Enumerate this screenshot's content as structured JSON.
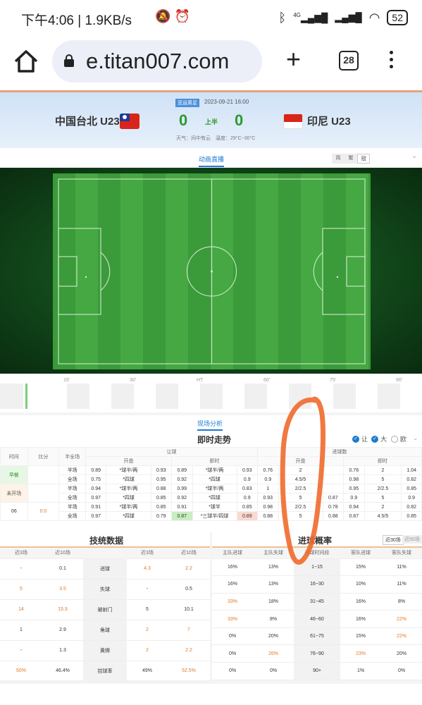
{
  "status_bar": {
    "time": "下午4:06",
    "speed": "1.9KB/s",
    "network": "4G",
    "battery": "52"
  },
  "browser": {
    "url": "e.titan007.com",
    "tab_count": "28"
  },
  "match": {
    "league": "亚运男足",
    "datetime": "2023-09-21 16:00",
    "home_team": "中国台北 U23",
    "away_team": "印尼 U23",
    "home_score": "0",
    "away_score": "0",
    "period": "上半",
    "weather": "天气：间中有云",
    "temperature": "温度：29°C~30°C"
  },
  "live_tab": {
    "label": "动画直播",
    "lang_options": [
      "简",
      "繁",
      "冠"
    ]
  },
  "timeline": {
    "labels": [
      "15'",
      "30'",
      "HT",
      "60'",
      "75'",
      "90'"
    ]
  },
  "analysis": {
    "tab": "现场分析",
    "title": "即时走势",
    "options": [
      "让",
      "大",
      "欧"
    ],
    "headers": {
      "time": "时间",
      "score": "比分",
      "half_full": "半全场",
      "handicap": "让球",
      "total": "进球数",
      "open": "开盘",
      "live": "即时"
    },
    "rows": [
      {
        "label": "早餐",
        "score": "",
        "type": "半场",
        "h_open": [
          "0.89",
          "*球半/两",
          "0.93"
        ],
        "h_live": [
          "0.89",
          "*球半/两",
          "0.93"
        ],
        "t_open": [
          "0.76",
          "2",
          ""
        ],
        "t_live": [
          "0.76",
          "2",
          "1.04"
        ]
      },
      {
        "label": "",
        "score": "",
        "type": "全场",
        "h_open": [
          "0.75",
          "*四球",
          "0.95"
        ],
        "h_live": [
          "0.92",
          "*四球",
          "0.9"
        ],
        "t_open": [
          "0.9",
          "4.5/5",
          ""
        ],
        "t_live": [
          "0.98",
          "5",
          "0.82"
        ]
      },
      {
        "label": "未开场",
        "score": "",
        "type": "半场",
        "h_open": [
          "0.94",
          "*球半/两",
          "0.88"
        ],
        "h_live": [
          "0.99",
          "*球半/两",
          "0.83"
        ],
        "t_open": [
          "1",
          "2/2.5",
          ""
        ],
        "t_live": [
          "0.95",
          "2/2.5",
          "0.85"
        ]
      },
      {
        "label": "",
        "score": "",
        "type": "全场",
        "h_open": [
          "0.97",
          "*四球",
          "0.85"
        ],
        "h_live": [
          "0.92",
          "*四球",
          "0.9"
        ],
        "t_open": [
          "0.93",
          "5",
          "0.87"
        ],
        "t_live": [
          "0.9",
          "5",
          "0.9"
        ]
      },
      {
        "label": "06",
        "score": "0:0",
        "type": "半场",
        "h_open": [
          "0.91",
          "*球半/两",
          "0.85"
        ],
        "h_live": [
          "0.91",
          "*球半",
          "0.85"
        ],
        "t_open": [
          "0.98",
          "2/2.5",
          "0.78"
        ],
        "t_live": [
          "0.94",
          "2",
          "0.82"
        ]
      },
      {
        "label": "",
        "score": "",
        "type": "全场",
        "h_open": [
          "0.97",
          "*四球",
          "0.79"
        ],
        "h_live": [
          "0.87",
          "*三球半/四球",
          "0.89"
        ],
        "t_open": [
          "0.88",
          "5",
          "0.88"
        ],
        "t_live": [
          "0.87",
          "4.5/5",
          "0.85"
        ]
      }
    ]
  },
  "tech_stats": {
    "title": "技统数据",
    "headers": [
      "近3场",
      "近10场",
      "",
      "近3场",
      "近10场"
    ],
    "rows": [
      {
        "a3": "-",
        "a10": "0.1",
        "name": "进球",
        "b3": "4.3",
        "b10": "2.2"
      },
      {
        "a3": "5",
        "a10": "3.5",
        "name": "失球",
        "b3": "-",
        "b10": "0.5"
      },
      {
        "a3": "14",
        "a10": "15.3",
        "name": "被射门",
        "b3": "5",
        "b10": "10.1"
      },
      {
        "a3": "1",
        "a10": "2.9",
        "name": "角球",
        "b3": "2",
        "b10": "7"
      },
      {
        "a3": "-",
        "a10": "1.3",
        "name": "黄牌",
        "b3": "2",
        "b10": "2.2"
      },
      {
        "a3": "50%",
        "a10": "46.4%",
        "name": "控球率",
        "b3": "49%",
        "b10": "52.5%"
      }
    ]
  },
  "goal_prob": {
    "title": "进球概率",
    "seg_on": "近30场",
    "seg_off": "近50场",
    "headers": [
      "主队进球",
      "主队失球",
      "进球时间段",
      "客队进球",
      "客队失球"
    ],
    "rows": [
      {
        "hg": "16%",
        "hl": "13%",
        "range": "1~15",
        "ag": "15%",
        "al": "11%"
      },
      {
        "hg": "16%",
        "hl": "13%",
        "range": "16~30",
        "ag": "10%",
        "al": "11%"
      },
      {
        "hg": "33%",
        "hl": "18%",
        "range": "31~45",
        "ag": "16%",
        "al": "8%"
      },
      {
        "hg": "33%",
        "hl": "8%",
        "range": "46~60",
        "ag": "16%",
        "al": "22%"
      },
      {
        "hg": "0%",
        "hl": "20%",
        "range": "61~75",
        "ag": "15%",
        "al": "22%"
      },
      {
        "hg": "0%",
        "hl": "26%",
        "range": "76~90",
        "ag": "23%",
        "al": "20%"
      },
      {
        "hg": "0%",
        "hl": "0%",
        "range": "90+",
        "ag": "1%",
        "al": "0%"
      }
    ]
  },
  "colors": {
    "accent": "#1f7ad0",
    "score_green": "#2c9a2c",
    "highlight_orange": "#e07a2a",
    "scribble": "#f06a2c"
  }
}
